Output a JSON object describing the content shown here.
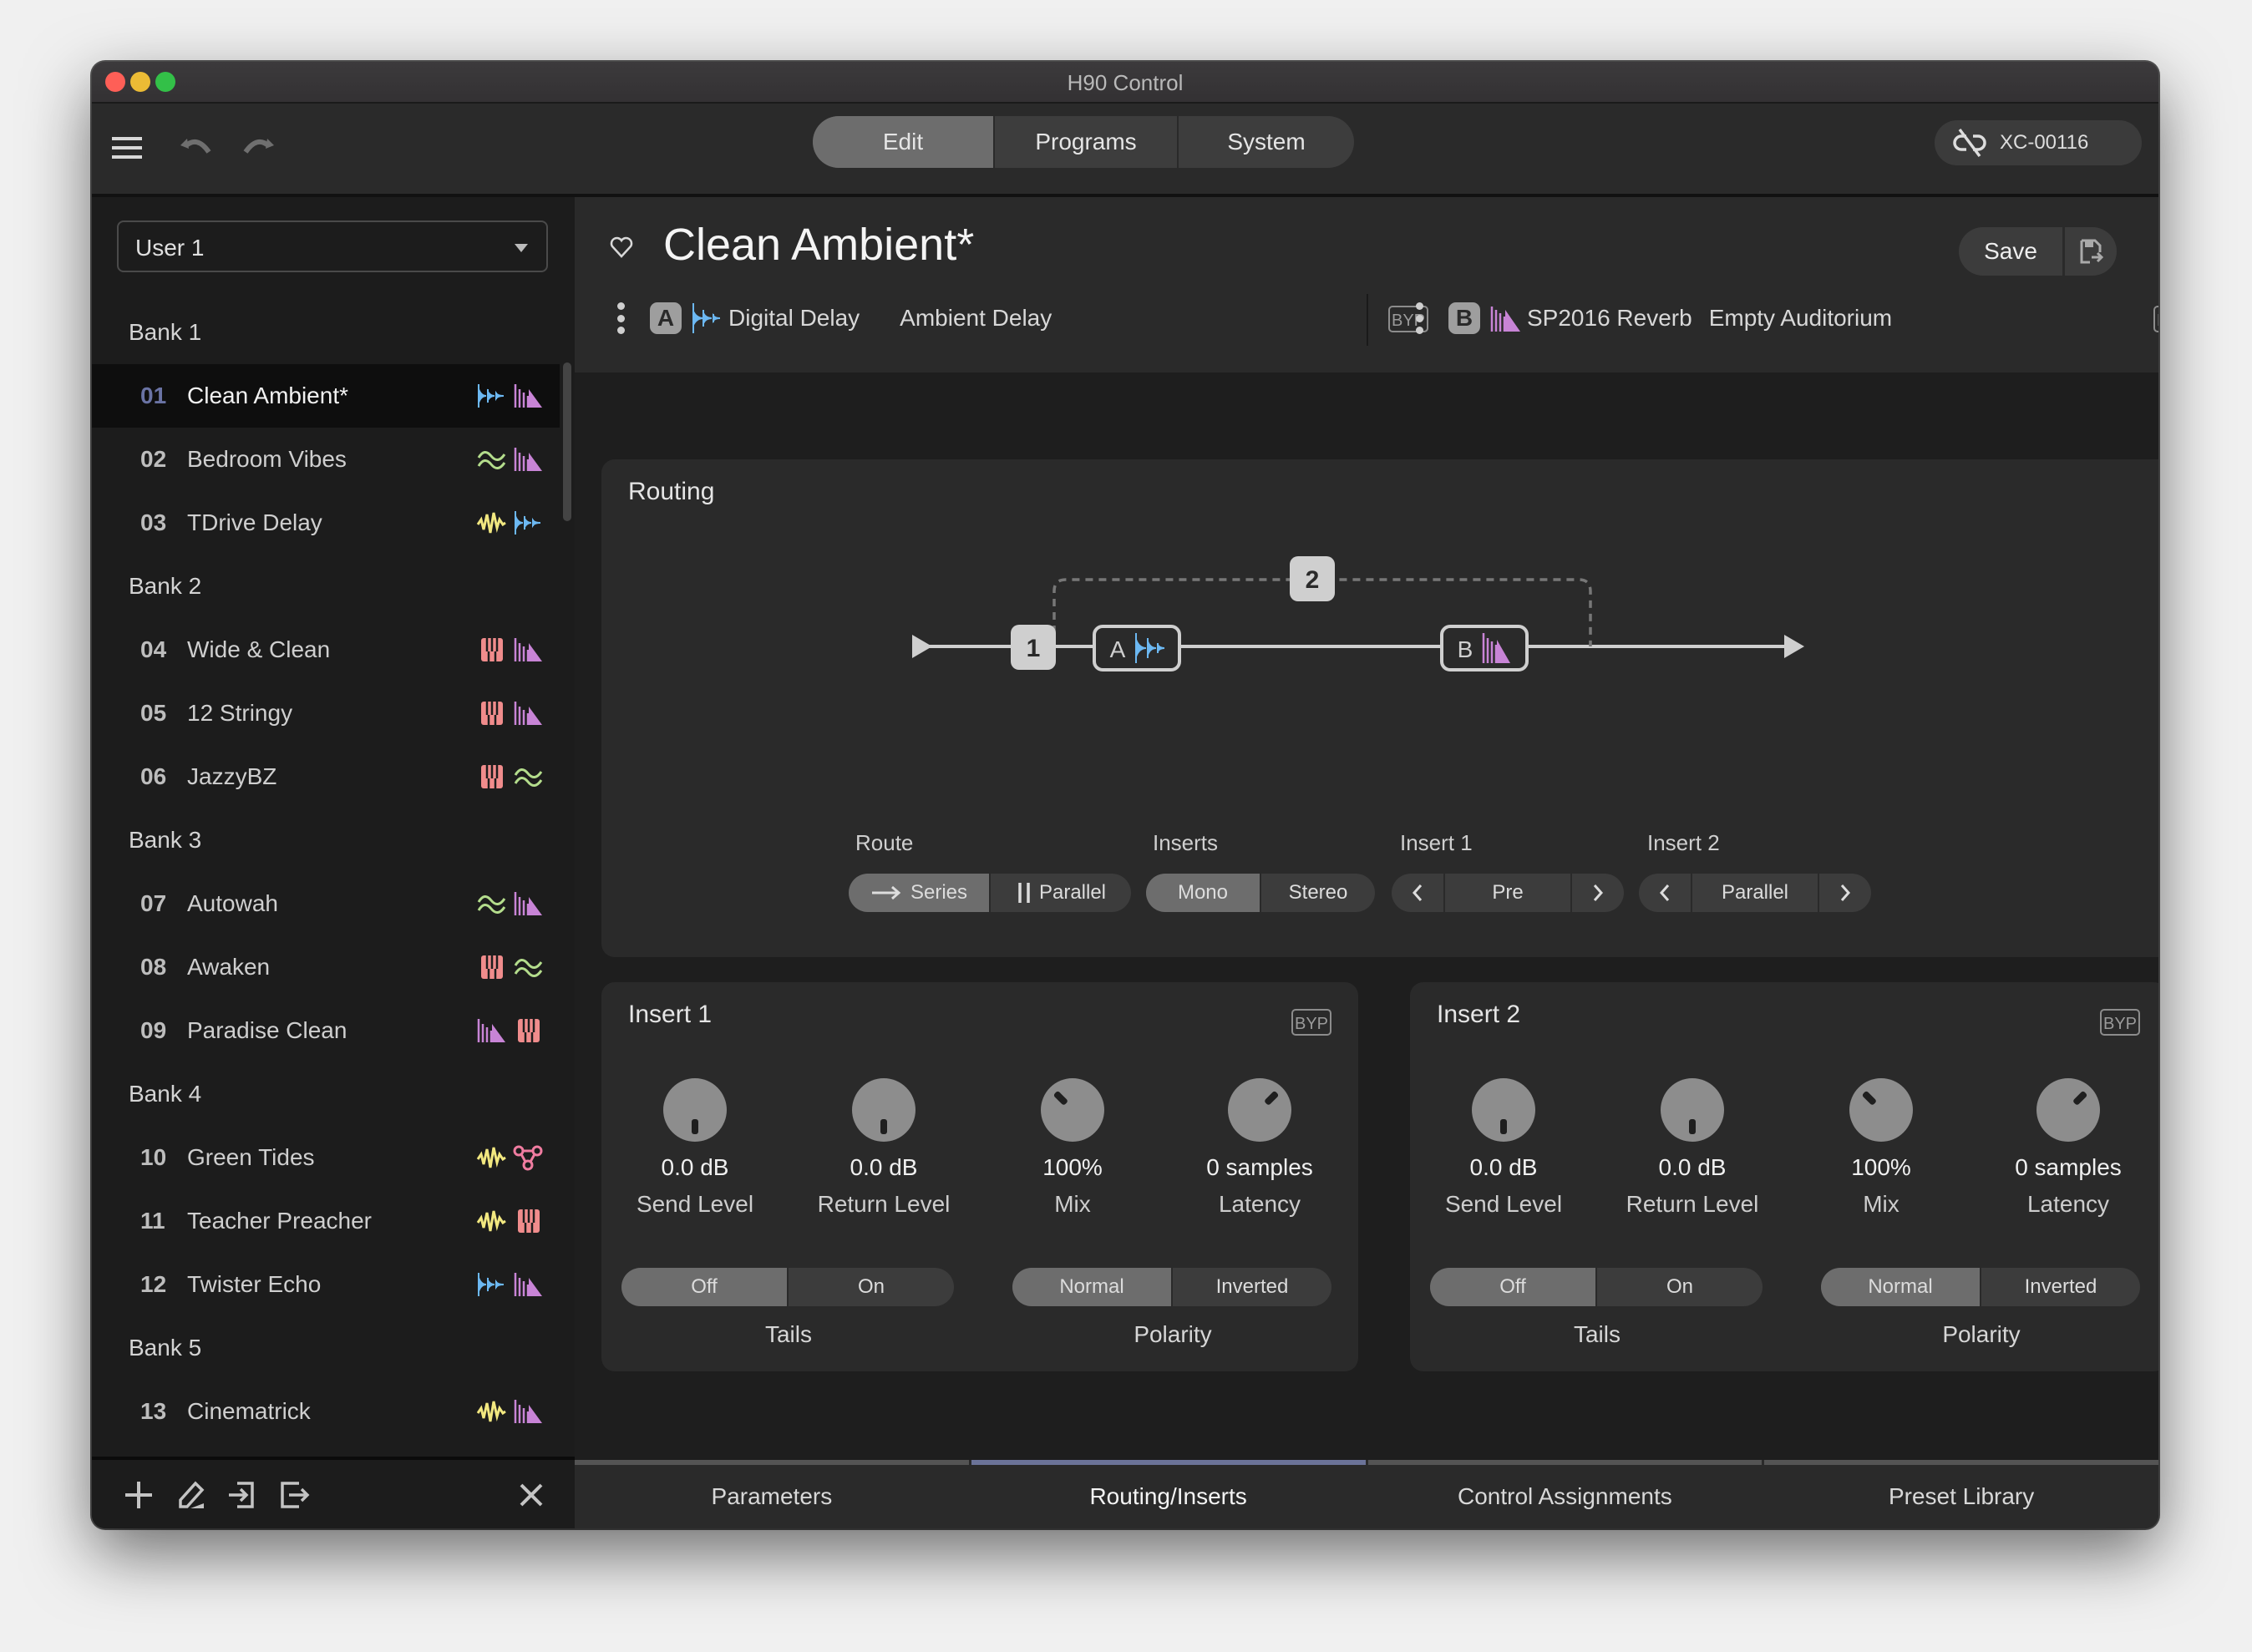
{
  "window": {
    "title": "H90 Control"
  },
  "toolbar": {
    "tabs": [
      {
        "label": "Edit",
        "active": true
      },
      {
        "label": "Programs",
        "active": false
      },
      {
        "label": "System",
        "active": false
      }
    ],
    "device": {
      "label": "XC-00116",
      "icon": "link-off-icon"
    }
  },
  "sidebar": {
    "dropdown": {
      "value": "User 1"
    },
    "banks": [
      {
        "label": "Bank 1",
        "items": [
          {
            "num": "01",
            "name": "Clean Ambient*",
            "icons": [
              "delay",
              "reverb"
            ],
            "selected": true
          },
          {
            "num": "02",
            "name": "Bedroom Vibes",
            "icons": [
              "modulation",
              "reverb"
            ]
          },
          {
            "num": "03",
            "name": "TDrive Delay",
            "icons": [
              "distortion",
              "delay"
            ]
          }
        ]
      },
      {
        "label": "Bank 2",
        "items": [
          {
            "num": "04",
            "name": "Wide & Clean",
            "icons": [
              "pitch",
              "reverb"
            ]
          },
          {
            "num": "05",
            "name": "12 Stringy",
            "icons": [
              "pitch",
              "reverb"
            ]
          },
          {
            "num": "06",
            "name": "JazzyBZ",
            "icons": [
              "pitch",
              "modulation"
            ]
          }
        ]
      },
      {
        "label": "Bank 3",
        "items": [
          {
            "num": "07",
            "name": "Autowah",
            "icons": [
              "modulation",
              "reverb"
            ]
          },
          {
            "num": "08",
            "name": "Awaken",
            "icons": [
              "pitch",
              "modulation"
            ]
          },
          {
            "num": "09",
            "name": "Paradise Clean",
            "icons": [
              "reverb",
              "pitch"
            ]
          }
        ]
      },
      {
        "label": "Bank 4",
        "items": [
          {
            "num": "10",
            "name": "Green Tides",
            "icons": [
              "distortion",
              "filter"
            ]
          },
          {
            "num": "11",
            "name": "Teacher Preacher",
            "icons": [
              "distortion",
              "pitch"
            ]
          },
          {
            "num": "12",
            "name": "Twister Echo",
            "icons": [
              "delay",
              "reverb"
            ]
          }
        ]
      },
      {
        "label": "Bank 5",
        "items": [
          {
            "num": "13",
            "name": "Cinematrick",
            "icons": [
              "distortion",
              "reverb"
            ]
          }
        ]
      }
    ],
    "footer_icons": [
      "add-icon",
      "edit-icon",
      "import-icon",
      "export-icon",
      "close-icon"
    ]
  },
  "colors": {
    "delay": "#6cb8f2",
    "reverb": "#c884d6",
    "modulation": "#b4dd8c",
    "distortion": "#f2e880",
    "pitch": "#f08c8c",
    "filter": "#f07ca0",
    "accent": "#6b7398"
  },
  "program": {
    "title": "Clean Ambient*",
    "save_label": "Save",
    "slot_a": {
      "letter": "A",
      "algorithm": "Digital Delay",
      "preset": "Ambient Delay",
      "bypass_label": "BYP"
    },
    "slot_b": {
      "letter": "B",
      "algorithm": "SP2016 Reverb",
      "preset": "Empty Auditorium",
      "bypass_label": "BYP"
    }
  },
  "routing": {
    "title": "Routing",
    "diagram": {
      "insert1_label": "1",
      "insert2_label": "2",
      "node_a": "A",
      "node_b": "B"
    },
    "route": {
      "label": "Route",
      "options": [
        "Series",
        "Parallel"
      ],
      "selected": "Series"
    },
    "inserts": {
      "label": "Inserts",
      "options": [
        "Mono",
        "Stereo"
      ],
      "selected": "Mono"
    },
    "insert1": {
      "label": "Insert 1",
      "value": "Pre"
    },
    "insert2": {
      "label": "Insert 2",
      "value": "Parallel"
    }
  },
  "insert_panels": [
    {
      "title": "Insert 1",
      "bypass_label": "BYP",
      "knobs": [
        {
          "value": "0.0 dB",
          "label": "Send Level",
          "position": 0.5
        },
        {
          "value": "0.0 dB",
          "label": "Return Level",
          "position": 0.5
        },
        {
          "value": "100%",
          "label": "Mix",
          "position": 1.0
        },
        {
          "value": "0 samples",
          "label": "Latency",
          "position": 0.0
        }
      ],
      "tails": {
        "label": "Tails",
        "options": [
          "Off",
          "On"
        ],
        "selected": "Off"
      },
      "polarity": {
        "label": "Polarity",
        "options": [
          "Normal",
          "Inverted"
        ],
        "selected": "Normal"
      }
    },
    {
      "title": "Insert 2",
      "bypass_label": "BYP",
      "knobs": [
        {
          "value": "0.0 dB",
          "label": "Send Level",
          "position": 0.5
        },
        {
          "value": "0.0 dB",
          "label": "Return Level",
          "position": 0.5
        },
        {
          "value": "100%",
          "label": "Mix",
          "position": 1.0
        },
        {
          "value": "0 samples",
          "label": "Latency",
          "position": 0.0
        }
      ],
      "tails": {
        "label": "Tails",
        "options": [
          "Off",
          "On"
        ],
        "selected": "Off"
      },
      "polarity": {
        "label": "Polarity",
        "options": [
          "Normal",
          "Inverted"
        ],
        "selected": "Normal"
      }
    }
  ],
  "bottom_tabs": [
    {
      "label": "Parameters",
      "active": false
    },
    {
      "label": "Routing/Inserts",
      "active": true
    },
    {
      "label": "Control Assignments",
      "active": false
    },
    {
      "label": "Preset Library",
      "active": false
    }
  ]
}
